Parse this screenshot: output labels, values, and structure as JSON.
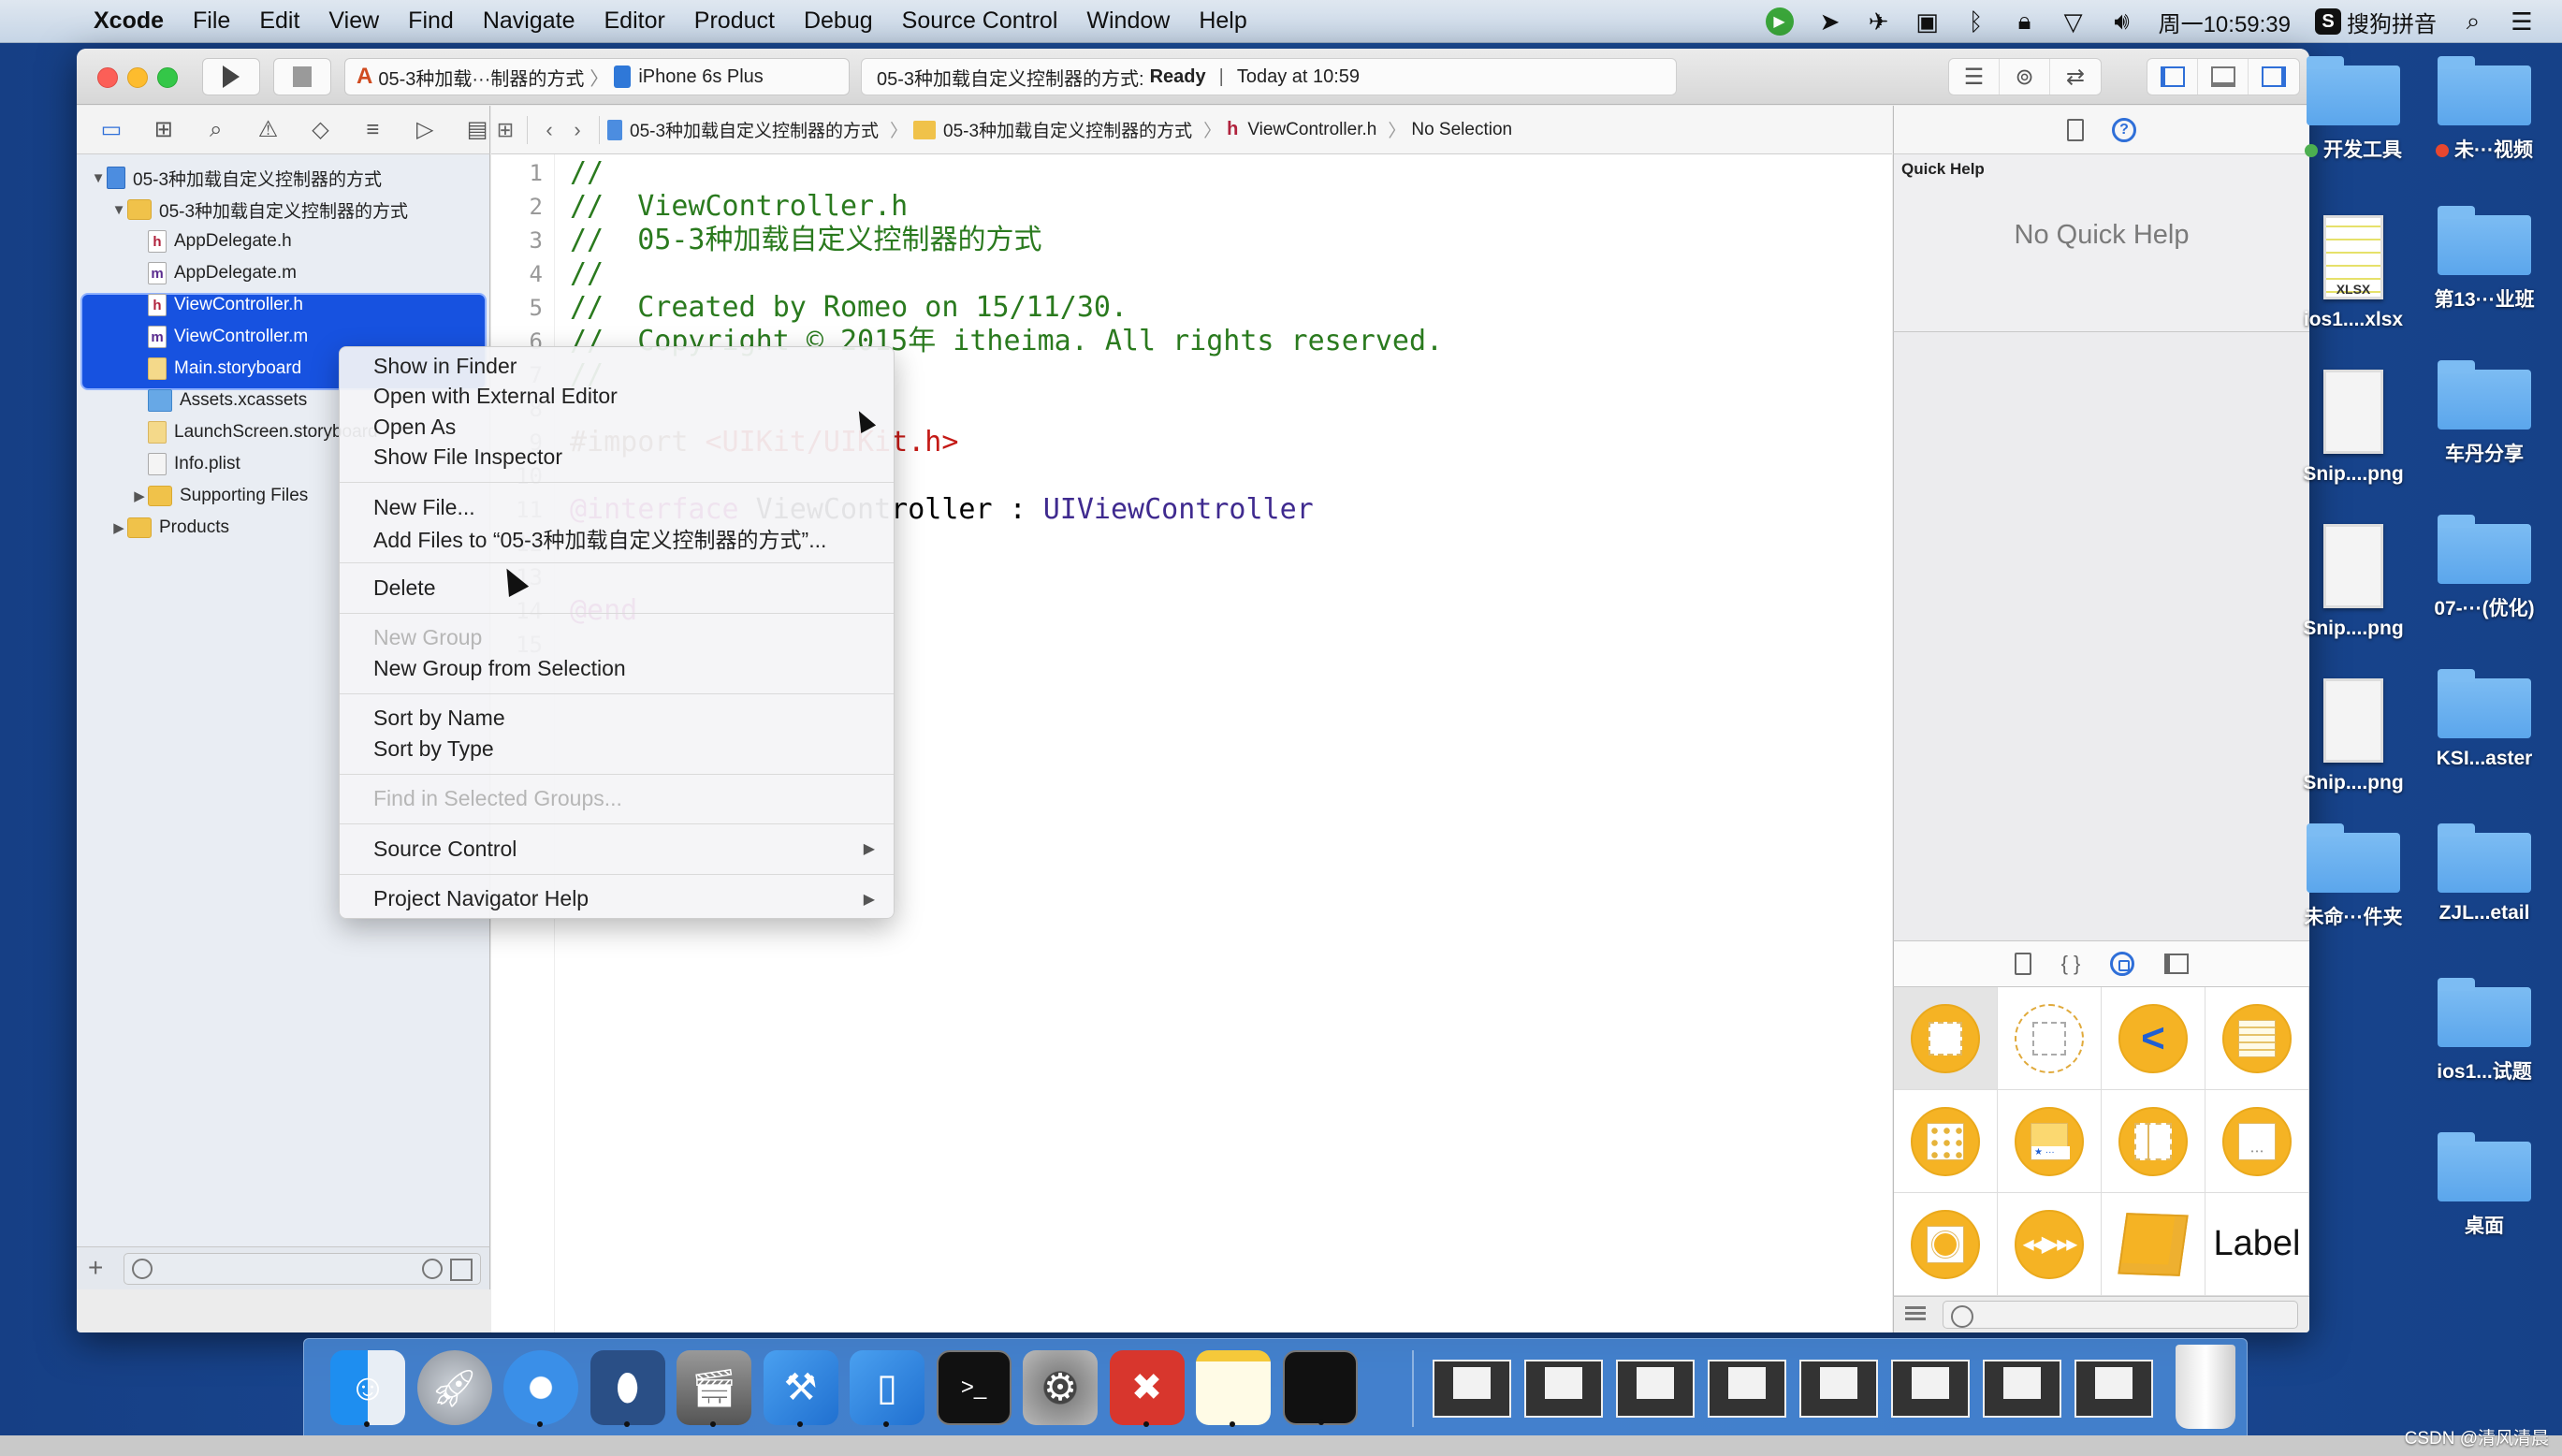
{
  "menubar": {
    "apple": "",
    "app_name": "Xcode",
    "items": [
      "File",
      "Edit",
      "View",
      "Find",
      "Navigate",
      "Editor",
      "Product",
      "Debug",
      "Source Control",
      "Window",
      "Help"
    ],
    "clock": "周一10:59:39",
    "input_method": "搜狗拼音",
    "status_icons": [
      "screen-recorder-icon",
      "location-icon",
      "airplane-icon",
      "camera-icon",
      "bluetooth-icon",
      "lock-icon",
      "wifi-icon",
      "volume-icon"
    ]
  },
  "toolbar": {
    "scheme": "05-3种加载···制器的方式",
    "device": "iPhone 6s Plus",
    "activity_project": "05-3种加载自定义控制器的方式:",
    "activity_status": "Ready",
    "activity_separator": "|",
    "activity_time": "Today at 10:59"
  },
  "navigator": {
    "tree": [
      {
        "label": "05-3种加载自定义控制器的方式",
        "type": "project",
        "level": 0,
        "disclosure": "open"
      },
      {
        "label": "05-3种加载自定义控制器的方式",
        "type": "folder",
        "level": 1,
        "disclosure": "open"
      },
      {
        "label": "AppDelegate.h",
        "type": "h",
        "level": 2
      },
      {
        "label": "AppDelegate.m",
        "type": "m",
        "level": 2
      },
      {
        "label": "ViewController.h",
        "type": "h",
        "level": 2,
        "selected": true
      },
      {
        "label": "ViewController.m",
        "type": "m",
        "level": 2,
        "selected": true
      },
      {
        "label": "Main.storyboard",
        "type": "storyboard",
        "level": 2,
        "selected": true
      },
      {
        "label": "Assets.xcassets",
        "type": "assets",
        "level": 2
      },
      {
        "label": "LaunchScreen.storyboard",
        "type": "storyboard",
        "level": 2
      },
      {
        "label": "Info.plist",
        "type": "plist",
        "level": 2
      },
      {
        "label": "Supporting Files",
        "type": "folder",
        "level": 2,
        "disclosure": "closed"
      },
      {
        "label": "Products",
        "type": "folder",
        "level": 1,
        "disclosure": "closed"
      }
    ]
  },
  "jumpbar": {
    "crumbs": [
      "05-3种加载自定义控制器的方式",
      "05-3种加载自定义控制器的方式",
      "ViewController.h",
      "No Selection"
    ]
  },
  "editor": {
    "lines": [
      {
        "n": "1",
        "text": "//"
      },
      {
        "n": "2",
        "text": "//  ViewController.h"
      },
      {
        "n": "3",
        "text": "//  05-3种加载自定义控制器的方式"
      },
      {
        "n": "4",
        "text": "//"
      },
      {
        "n": "5",
        "text": "//  Created by Romeo on 15/11/30."
      },
      {
        "n": "6",
        "text": "//  Copyright © 2015年 itheima. All rights reserved."
      },
      {
        "n": "7",
        "text": "//"
      },
      {
        "n": "8",
        "text": ""
      },
      {
        "n": "9",
        "import_kw": "#import ",
        "import_path": "<UIKit/UIKit.h>"
      },
      {
        "n": "10",
        "text": ""
      },
      {
        "n": "11",
        "kw": "@interface",
        "cls_name": " ViewController : ",
        "super": "UIViewController"
      },
      {
        "n": "12",
        "text": ""
      },
      {
        "n": "13",
        "text": ""
      },
      {
        "n": "14",
        "kw": "@end"
      },
      {
        "n": "15",
        "text": ""
      }
    ]
  },
  "context_menu": {
    "groups": [
      [
        {
          "label": "Show in Finder"
        },
        {
          "label": "Open with External Editor"
        },
        {
          "label": "Open As",
          "submenu": true,
          "arrow": ""
        },
        {
          "label": "Show File Inspector"
        }
      ],
      [
        {
          "label": "New File..."
        },
        {
          "label": "Add Files to “05-3种加载自定义控制器的方式”..."
        }
      ],
      [
        {
          "label": "Delete"
        }
      ],
      [
        {
          "label": "New Group",
          "disabled": true
        },
        {
          "label": "New Group from Selection"
        }
      ],
      [
        {
          "label": "Sort by Name"
        },
        {
          "label": "Sort by Type"
        }
      ],
      [
        {
          "label": "Find in Selected Groups...",
          "disabled": true
        }
      ],
      [
        {
          "label": "Source Control",
          "submenu": true,
          "arrow": "▶"
        }
      ],
      [
        {
          "label": "Project Navigator Help",
          "submenu": true,
          "arrow": "▶"
        }
      ]
    ]
  },
  "utilities": {
    "quick_help_title": "Quick Help",
    "quick_help_empty": "No Quick Help",
    "library_tabs": [
      "file-template-icon",
      "code-snippet-icon",
      "object-library-icon",
      "media-library-icon"
    ],
    "library_items": [
      {
        "name": "view-controller"
      },
      {
        "name": "storyboard-reference"
      },
      {
        "name": "navigation-controller"
      },
      {
        "name": "table-view-controller"
      },
      {
        "name": "collection-view-controller"
      },
      {
        "name": "tab-bar-controller"
      },
      {
        "name": "split-view-controller"
      },
      {
        "name": "page-view-controller"
      },
      {
        "name": "glkit-view-controller"
      },
      {
        "name": "avkit-player-view-controller"
      },
      {
        "name": "object"
      },
      {
        "name": "label",
        "text": "Label"
      }
    ]
  },
  "desktop": {
    "icons": [
      {
        "label": "开发工具",
        "tag": "#4caf50",
        "kind": "folder",
        "col": 0,
        "row": 0
      },
      {
        "label": "未···视频",
        "tag": "#e8472f",
        "kind": "folder",
        "col": 1,
        "row": 0
      },
      {
        "label": "ios1....xlsx",
        "kind": "xlsx",
        "col": 0,
        "row": 1,
        "file_text": "XLSX"
      },
      {
        "label": "第13···业班",
        "kind": "folder",
        "col": 1,
        "row": 1
      },
      {
        "label": "Snip....png",
        "kind": "png",
        "col": 0,
        "row": 2
      },
      {
        "label": "车丹分享",
        "kind": "folder",
        "col": 1,
        "row": 2
      },
      {
        "label": "Snip....png",
        "kind": "png",
        "col": 0,
        "row": 3
      },
      {
        "label": "07-···(优化)",
        "kind": "folder",
        "col": 1,
        "row": 3
      },
      {
        "label": "Snip....png",
        "kind": "png",
        "col": 0,
        "row": 4
      },
      {
        "label": "KSI...aster",
        "kind": "folder",
        "col": 1,
        "row": 4
      },
      {
        "label": "未命···件夹",
        "kind": "folder",
        "col": 0,
        "row": 5
      },
      {
        "label": "ZJL...etail",
        "kind": "folder",
        "col": 1,
        "row": 5
      },
      {
        "label": "ios1...试题",
        "kind": "folder",
        "col": 1,
        "row": 6
      },
      {
        "label": "桌面",
        "kind": "folder",
        "col": 1,
        "row": 7
      }
    ]
  },
  "dock": {
    "apps": [
      {
        "name": "finder",
        "running": true
      },
      {
        "name": "launchpad",
        "running": false
      },
      {
        "name": "safari",
        "running": true
      },
      {
        "name": "mouse-app",
        "running": true
      },
      {
        "name": "video-player",
        "running": true
      },
      {
        "name": "xcode",
        "running": true
      },
      {
        "name": "simulator",
        "running": true
      },
      {
        "name": "terminal",
        "running": false
      },
      {
        "name": "system-preferences",
        "running": false
      },
      {
        "name": "xmind",
        "running": true
      },
      {
        "name": "notes",
        "running": true
      },
      {
        "name": "console",
        "running": true
      }
    ],
    "minimized_windows": 8
  },
  "watermark": "CSDN @清风清晨"
}
